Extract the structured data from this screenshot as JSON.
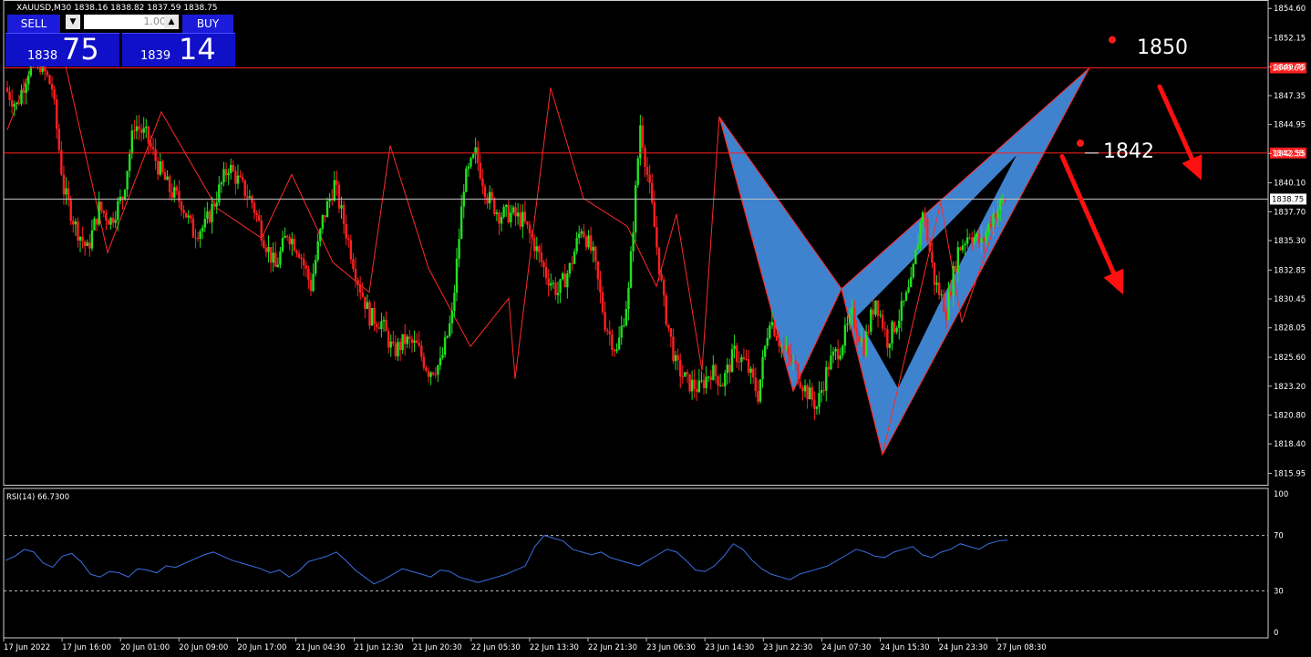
{
  "header": {
    "symbol_line": "XAUUSD,M30  1838.16 1838.82 1837.59 1838.75"
  },
  "trade_panel": {
    "sell_label": "SELL",
    "buy_label": "BUY",
    "lot": "1.00",
    "sell_small": "1838",
    "sell_big": "75",
    "buy_small": "1839",
    "buy_big": "14"
  },
  "annotations": {
    "level_high_text": "1850",
    "level_low_text": "1842"
  },
  "chart_data": [
    {
      "type": "candlestick",
      "title": "XAUUSD,M30",
      "ylim": [
        1815.0,
        1855.3
      ],
      "y_ticks": [
        "1854.60",
        "1852.15",
        "1849.75",
        "1847.35",
        "1844.95",
        "1842.55",
        "1840.10",
        "1837.70",
        "1835.30",
        "1832.85",
        "1830.45",
        "1828.05",
        "1825.60",
        "1823.20",
        "1820.80",
        "1818.40",
        "1815.95"
      ],
      "x_ticks": [
        "17 Jun 2022",
        "17 Jun 16:00",
        "20 Jun 01:00",
        "20 Jun 09:00",
        "20 Jun 17:00",
        "21 Jun 04:30",
        "21 Jun 12:30",
        "21 Jun 20:30",
        "22 Jun 05:30",
        "22 Jun 13:30",
        "22 Jun 21:30",
        "23 Jun 06:30",
        "23 Jun 14:30",
        "23 Jun 22:30",
        "24 Jun 07:30",
        "24 Jun 15:30",
        "24 Jun 23:30",
        "27 Jun 08:30"
      ],
      "horizontal_levels": [
        {
          "value": 1849.66,
          "label": "1849.66",
          "color": "#ff2020"
        },
        {
          "value": 1842.58,
          "label": "1842.58",
          "color": "#ff2020"
        },
        {
          "value": 1838.75,
          "label": "1838.75",
          "color": "#c0c0c0"
        }
      ],
      "close_path": [
        1848.0,
        1846.5,
        1849.5,
        1850.0,
        1848.0,
        1839.5,
        1836.5,
        1834.5,
        1838.0,
        1837.0,
        1839.0,
        1845.0,
        1844.0,
        1841.5,
        1839.5,
        1838.5,
        1836.0,
        1836.5,
        1839.0,
        1841.5,
        1840.0,
        1838.5,
        1835.5,
        1833.0,
        1836.0,
        1834.5,
        1831.5,
        1837.0,
        1840.0,
        1836.0,
        1832.0,
        1829.0,
        1828.5,
        1826.0,
        1827.0,
        1826.5,
        1824.5,
        1825.0,
        1829.0,
        1840.0,
        1842.5,
        1839.0,
        1837.5,
        1837.5,
        1837.0,
        1835.0,
        1832.5,
        1831.0,
        1833.0,
        1836.5,
        1834.0,
        1828.5,
        1826.0,
        1831.0,
        1845.0,
        1838.0,
        1830.0,
        1825.0,
        1823.5,
        1823.0,
        1824.5,
        1823.5,
        1826.0,
        1825.0,
        1822.5,
        1829.0,
        1826.5,
        1825.0,
        1823.0,
        1821.5,
        1825.0,
        1826.5,
        1829.0,
        1826.5,
        1830.5,
        1827.0,
        1829.0,
        1831.5,
        1838.0,
        1832.0,
        1829.5,
        1834.5,
        1836.0,
        1835.0,
        1837.5,
        1838.75
      ],
      "harmonic_points": [
        {
          "t": 789,
          "price": 1845.6
        },
        {
          "t": 870,
          "price": 1822.8
        },
        {
          "t": 923,
          "price": 1831.3
        },
        {
          "t": 968,
          "price": 1817.5
        },
        {
          "t": 1195,
          "price": 1849.66
        }
      ],
      "annotation_points": [
        {
          "t": 1220,
          "price": 1852.0
        },
        {
          "t": 1185,
          "price": 1843.4
        }
      ],
      "arrows": [
        {
          "from": [
            1272,
            1848.1
          ],
          "to": [
            1318,
            1840.3
          ]
        },
        {
          "from": [
            1165,
            1842.3
          ],
          "to": [
            1232,
            1830.8
          ]
        }
      ]
    },
    {
      "type": "line",
      "title": "RSI(14) 66.7300",
      "ylim": [
        0,
        100
      ],
      "y_ticks": [
        "100",
        "70",
        "30",
        "0"
      ],
      "levels": [
        70,
        30
      ],
      "values": [
        52,
        55,
        60,
        58,
        50,
        47,
        55,
        57,
        51,
        42,
        40,
        44,
        43,
        40,
        46,
        45,
        43,
        48,
        47,
        50,
        53,
        56,
        58,
        55,
        52,
        50,
        48,
        46,
        43,
        45,
        40,
        44,
        51,
        53,
        55,
        58,
        52,
        45,
        40,
        35,
        38,
        42,
        46,
        44,
        42,
        40,
        45,
        44,
        40,
        38,
        36,
        38,
        40,
        42,
        45,
        48,
        62,
        70,
        68,
        66,
        60,
        58,
        56,
        58,
        54,
        52,
        50,
        48,
        52,
        56,
        60,
        58,
        52,
        45,
        44,
        48,
        55,
        64,
        60,
        52,
        46,
        42,
        40,
        38,
        42,
        44,
        46,
        48,
        52,
        56,
        60,
        58,
        55,
        54,
        58,
        60,
        62,
        56,
        54,
        58,
        60,
        64,
        62,
        60,
        64,
        66,
        66.73
      ],
      "color": "#3a6fe0"
    }
  ]
}
